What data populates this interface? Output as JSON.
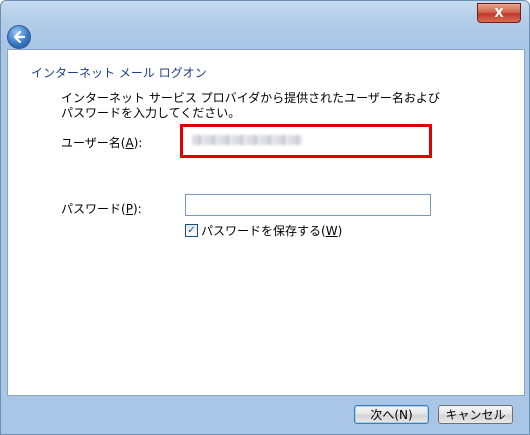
{
  "window": {
    "close_label": "X"
  },
  "page": {
    "title": "インターネット メール ログオン",
    "instructions": "インターネット サービス プロバイダから提供されたユーザー名およびパスワードを入力してください。"
  },
  "form": {
    "username": {
      "label_prefix": "ユーザー名(",
      "label_mnemonic": "A",
      "label_suffix": "):"
    },
    "password": {
      "label_prefix": "パスワード(",
      "label_mnemonic": "P",
      "label_suffix": "):",
      "value": ""
    },
    "remember": {
      "label_prefix": "パスワードを保存する(",
      "label_mnemonic": "W",
      "label_suffix": ")",
      "checked": true
    }
  },
  "buttons": {
    "next": "次へ(N)",
    "cancel": "キャンセル"
  },
  "colors": {
    "highlight": "#e00000",
    "title_text": "#1e3d8a"
  },
  "icons": {
    "back": "back-arrow-icon",
    "check": "checkmark-icon"
  }
}
